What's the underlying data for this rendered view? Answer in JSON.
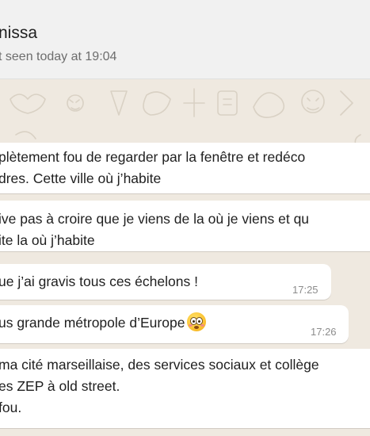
{
  "header": {
    "contact_name": "nissa",
    "status": "t seen today at 19:04"
  },
  "messages": [
    {
      "lines": [
        "plètement fou de regarder par la fenêtre et redéco",
        "dres. Cette ville où j’habite"
      ],
      "time": ""
    },
    {
      "lines": [
        "ive pas à croire que je viens de la où je viens et qu",
        "ite la où j’habite"
      ],
      "time": ""
    },
    {
      "lines": [
        "ue j’ai gravis tous ces échelons !"
      ],
      "time": "17:25"
    },
    {
      "lines": [
        "us grande métropole d’Europe"
      ],
      "emoji": "flushed-face-emoji",
      "time": "17:26"
    },
    {
      "lines": [
        "ma cité marseillaise, des services sociaux et collège",
        "es ZEP à old street.",
        "fou."
      ],
      "time": ""
    }
  ],
  "colors": {
    "header_bg": "#f1f1f1",
    "chat_bg": "#efe9e0",
    "bubble_bg": "#ffffff",
    "text": "#1f1f1f",
    "secondary_text": "#6d6d6d",
    "timestamp": "#8c8c8c"
  }
}
